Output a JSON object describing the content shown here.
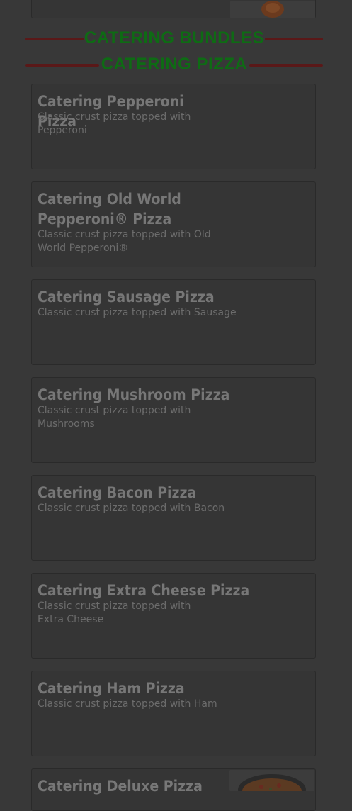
{
  "sections": {
    "bundles_header": "CATERING BUNDLES",
    "pizza_header": "CATERING PIZZA"
  },
  "items": [
    {
      "title": "Catering Pepperoni Pizza",
      "desc": "Classic crust pizza topped with Pepperoni"
    },
    {
      "title": "Catering Old World Pepperoni® Pizza",
      "desc": "Classic crust pizza topped with Old World Pepperoni®"
    },
    {
      "title": "Catering Sausage Pizza",
      "desc": "Classic crust pizza topped with Sausage"
    },
    {
      "title": "Catering Mushroom Pizza",
      "desc": "Classic crust pizza topped with Mushrooms"
    },
    {
      "title": "Catering Bacon Pizza",
      "desc": "Classic crust pizza topped with Bacon"
    },
    {
      "title": "Catering Extra Cheese Pizza",
      "desc": "Classic crust pizza topped with Extra Cheese"
    },
    {
      "title": "Catering Ham Pizza",
      "desc": "Classic crust pizza topped with Ham"
    },
    {
      "title": "Catering Deluxe Pizza",
      "desc": ""
    }
  ],
  "colors": {
    "overlay": "#383838",
    "header_text": "#0e6b14",
    "header_rule": "#5a1818"
  }
}
